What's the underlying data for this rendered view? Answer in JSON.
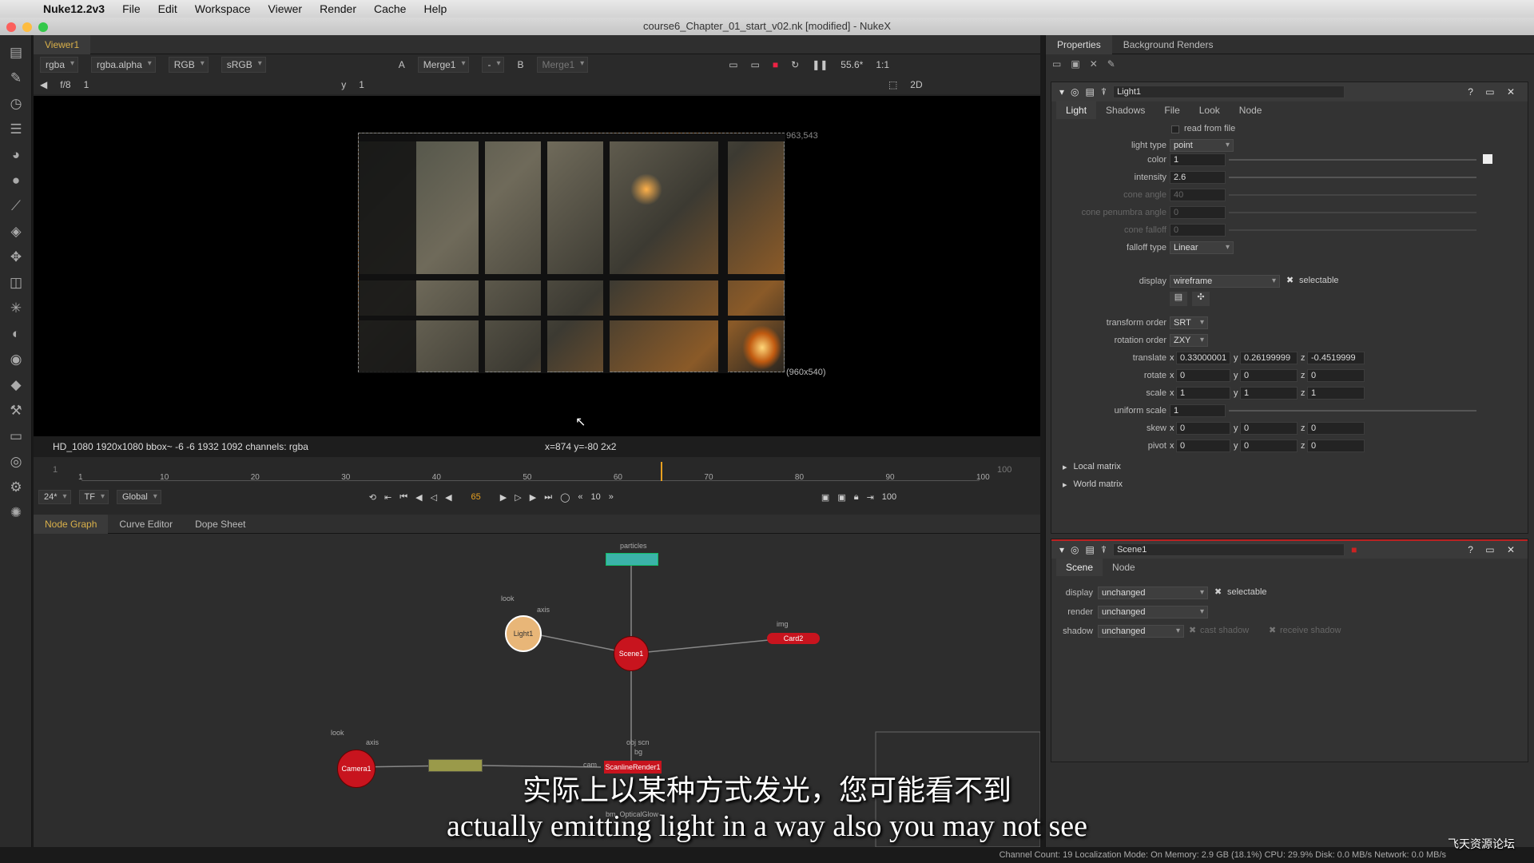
{
  "menubar": {
    "app": "Nuke12.2v3",
    "menus": [
      "File",
      "Edit",
      "Workspace",
      "Viewer",
      "Render",
      "Cache",
      "Help"
    ]
  },
  "window": {
    "title": "course6_Chapter_01_start_v02.nk [modified] - NukeX"
  },
  "viewer": {
    "tab": "Viewer1",
    "controls": {
      "channels": "rgba",
      "alpha": "rgba.alpha",
      "color": "RGB",
      "lut": "sRGB",
      "a_label": "A",
      "a_input": "Merge1",
      "a_op": "-",
      "b_label": "B",
      "b_input": "Merge1",
      "zoom": "55.6*",
      "ratio": "1:1",
      "mode": "2D"
    },
    "row2": {
      "frame_label": "f/8",
      "frame_val": "1",
      "y_label": "y",
      "y_val": "1"
    },
    "img_coords_top": "963,543",
    "img_coords_br": "(960x540)",
    "info": "HD_1080 1920x1080  bbox~ -6 -6 1932 1092 channels: rgba",
    "pointer": "x=874 y=-80 2x2"
  },
  "timeline": {
    "start": "1",
    "end": "100",
    "ticks": [
      "1",
      "10",
      "20",
      "30",
      "40",
      "50",
      "60",
      "70",
      "80",
      "90",
      "100"
    ],
    "current": "65",
    "fps": "24*",
    "tf": "TF",
    "global": "Global",
    "step": "10",
    "end_field": "100",
    "playhead_frac": 0.645
  },
  "nodegraph": {
    "tabs": [
      "Node Graph",
      "Curve Editor",
      "Dope Sheet"
    ],
    "nodes": {
      "light": "Light1",
      "scene": "Scene1",
      "card": "Card2",
      "camera": "Camera1",
      "render": "ScanlineRender1"
    },
    "labels": {
      "particles": "particles",
      "look1": "look",
      "axis1": "axis",
      "img": "img",
      "look2": "look",
      "axis2": "axis",
      "obj": "obj scn",
      "bg": "bg",
      "cam": "cam",
      "bm": "bm_OpticalGlow"
    }
  },
  "properties": {
    "tabs": [
      "Properties",
      "Background Renders"
    ],
    "light": {
      "name": "Light1",
      "tabs": [
        "Light",
        "Shadows",
        "File",
        "Look",
        "Node"
      ],
      "read_from_file": "read from file",
      "light_type_label": "light type",
      "light_type": "point",
      "color_label": "color",
      "color": "1",
      "intensity_label": "intensity",
      "intensity": "2.6",
      "cone_angle_label": "cone angle",
      "cone_angle": "40",
      "cone_penumbra_label": "cone penumbra angle",
      "cone_penumbra": "0",
      "cone_falloff_label": "cone falloff",
      "cone_falloff": "0",
      "falloff_label": "falloff type",
      "falloff": "Linear",
      "display_label": "display",
      "display": "wireframe",
      "selectable": "selectable",
      "transform_order_label": "transform order",
      "transform_order": "SRT",
      "rotation_order_label": "rotation order",
      "rotation_order": "ZXY",
      "translate_label": "translate",
      "tx": "0.33000001",
      "ty": "0.26199999",
      "tz": "-0.4519999",
      "rotate_label": "rotate",
      "rx": "0",
      "ry": "0",
      "rz": "0",
      "scale_label": "scale",
      "sx": "1",
      "sy": "1",
      "sz": "1",
      "uniform_label": "uniform scale",
      "uniform": "1",
      "skew_label": "skew",
      "kx": "0",
      "ky": "0",
      "kz": "0",
      "pivot_label": "pivot",
      "px": "0",
      "py": "0",
      "pz": "0",
      "local_matrix": "Local matrix",
      "world_matrix": "World matrix",
      "x": "x",
      "y": "y",
      "z": "z"
    },
    "scene": {
      "name": "Scene1",
      "tabs": [
        "Scene",
        "Node"
      ],
      "display_label": "display",
      "display": "unchanged",
      "selectable": "selectable",
      "render_label": "render",
      "render": "unchanged",
      "shadow_label": "shadow",
      "shadow": "unchanged",
      "cast": "cast shadow",
      "receive": "receive shadow"
    }
  },
  "status": "Channel Count: 19  Localization Mode: On  Memory: 2.9 GB (18.1%)  CPU: 29.9%  Disk: 0.0 MB/s  Network: 0.0 MB/s",
  "subtitles": {
    "zh": "实际上以某种方式发光，您可能看不到",
    "en": "actually emitting light in a way also you may not see"
  },
  "watermark": "飞天资源论坛"
}
